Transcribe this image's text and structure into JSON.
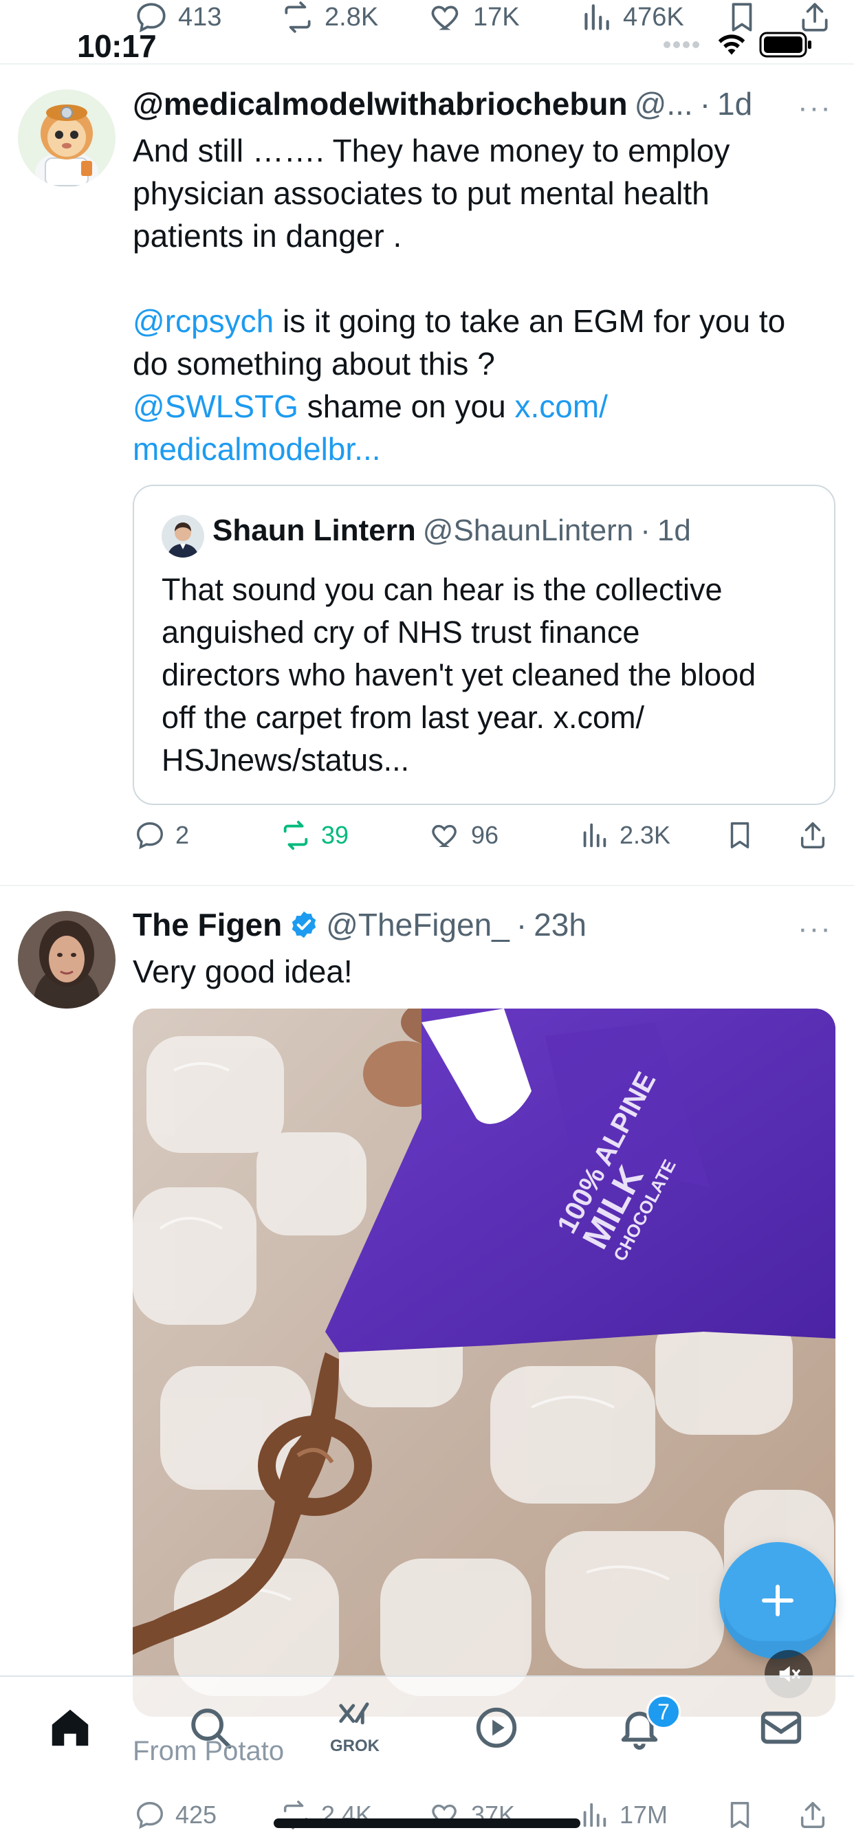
{
  "status_bar": {
    "time": "10:17"
  },
  "prev_tweet_actions": {
    "replies": "413",
    "reposts": "2.8K",
    "likes": "17K",
    "views": "476K"
  },
  "tweet1": {
    "author_name": "@medicalmodelwithabriochebun",
    "handle": "@...",
    "sep": "·",
    "time": "1d",
    "more": "···",
    "line1": "And still ……. They have money to employ",
    "line2": "physician associates to  put mental health",
    "line3": "patients in danger .",
    "mention1": "@rcpsych",
    "line4_rest": " is it going to take an EGM for you to",
    "line5": "do something about this ?",
    "mention2": "@SWLSTG",
    "line6_rest": " shame on you ",
    "link_part1": "x.com/",
    "link_part2": "medicalmodelbr...",
    "quote": {
      "name": "Shaun Lintern",
      "handle": "@ShaunLintern",
      "sep": "·",
      "time": "1d",
      "l1": "That sound you can hear is the collective",
      "l2": "anguished cry of NHS trust finance",
      "l3": "directors who haven't yet cleaned the blood",
      "l4": "off the carpet from last year. x.com/",
      "l5": "HSJnews/status..."
    },
    "actions": {
      "replies": "2",
      "reposts": "39",
      "likes": "96",
      "views": "2.3K"
    }
  },
  "tweet2": {
    "author_name": "The Figen",
    "handle": "@TheFigen_",
    "sep": "·",
    "time": "23h",
    "more": "···",
    "text": "Very good idea!",
    "media_text": "100% ALPINE MILK CHOCOLATE",
    "from_label": "From Potato",
    "actions": {
      "replies": "425",
      "reposts": "2.4K",
      "likes": "37K",
      "views": "17M"
    }
  },
  "nav": {
    "grok_label": "GROK",
    "notifications_badge": "7"
  },
  "colors": {
    "accent": "#1d9bf0",
    "repost_active": "#00ba7c",
    "text": "#0f1419",
    "muted": "#536471"
  }
}
